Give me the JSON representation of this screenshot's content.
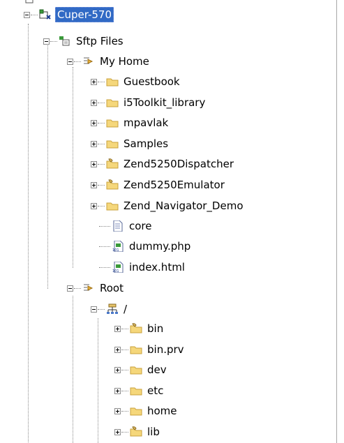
{
  "tree": {
    "connection": {
      "label": "Cuper-570",
      "icon": "connection-icon",
      "selected": true
    },
    "sftp": {
      "label": "Sftp Files",
      "icon": "sftp-files-icon"
    },
    "my_home": {
      "label": "My Home",
      "icon": "filter-arrow-icon",
      "children": [
        {
          "label": "Guestbook",
          "icon": "folder-icon",
          "expandable": true
        },
        {
          "label": "i5Toolkit_library",
          "icon": "folder-icon",
          "expandable": true
        },
        {
          "label": "mpavlak",
          "icon": "folder-icon",
          "expandable": true
        },
        {
          "label": "Samples",
          "icon": "folder-icon",
          "expandable": true
        },
        {
          "label": "Zend5250Dispatcher",
          "icon": "shared-folder-icon",
          "expandable": true
        },
        {
          "label": "Zend5250Emulator",
          "icon": "shared-folder-icon",
          "expandable": true
        },
        {
          "label": "Zend_Navigator_Demo",
          "icon": "folder-icon",
          "expandable": true
        },
        {
          "label": "core",
          "icon": "text-file-icon",
          "expandable": false
        },
        {
          "label": "dummy.php",
          "icon": "binary-file-icon",
          "expandable": false
        },
        {
          "label": "index.html",
          "icon": "binary-file-icon",
          "expandable": false
        }
      ]
    },
    "root": {
      "label": "Root",
      "icon": "filter-arrow-icon",
      "slash": {
        "label": "/",
        "icon": "network-root-icon",
        "children": [
          {
            "label": "bin",
            "icon": "shared-folder-icon",
            "expandable": true
          },
          {
            "label": "bin.prv",
            "icon": "folder-icon",
            "expandable": true
          },
          {
            "label": "dev",
            "icon": "folder-icon",
            "expandable": true
          },
          {
            "label": "etc",
            "icon": "folder-icon",
            "expandable": true
          },
          {
            "label": "home",
            "icon": "folder-icon",
            "expandable": true
          },
          {
            "label": "lib",
            "icon": "shared-folder-icon",
            "expandable": true
          }
        ]
      }
    }
  },
  "colors": {
    "selection": "#316ac5",
    "folder": "#f5d77b",
    "folder_edge": "#c9a23b"
  }
}
